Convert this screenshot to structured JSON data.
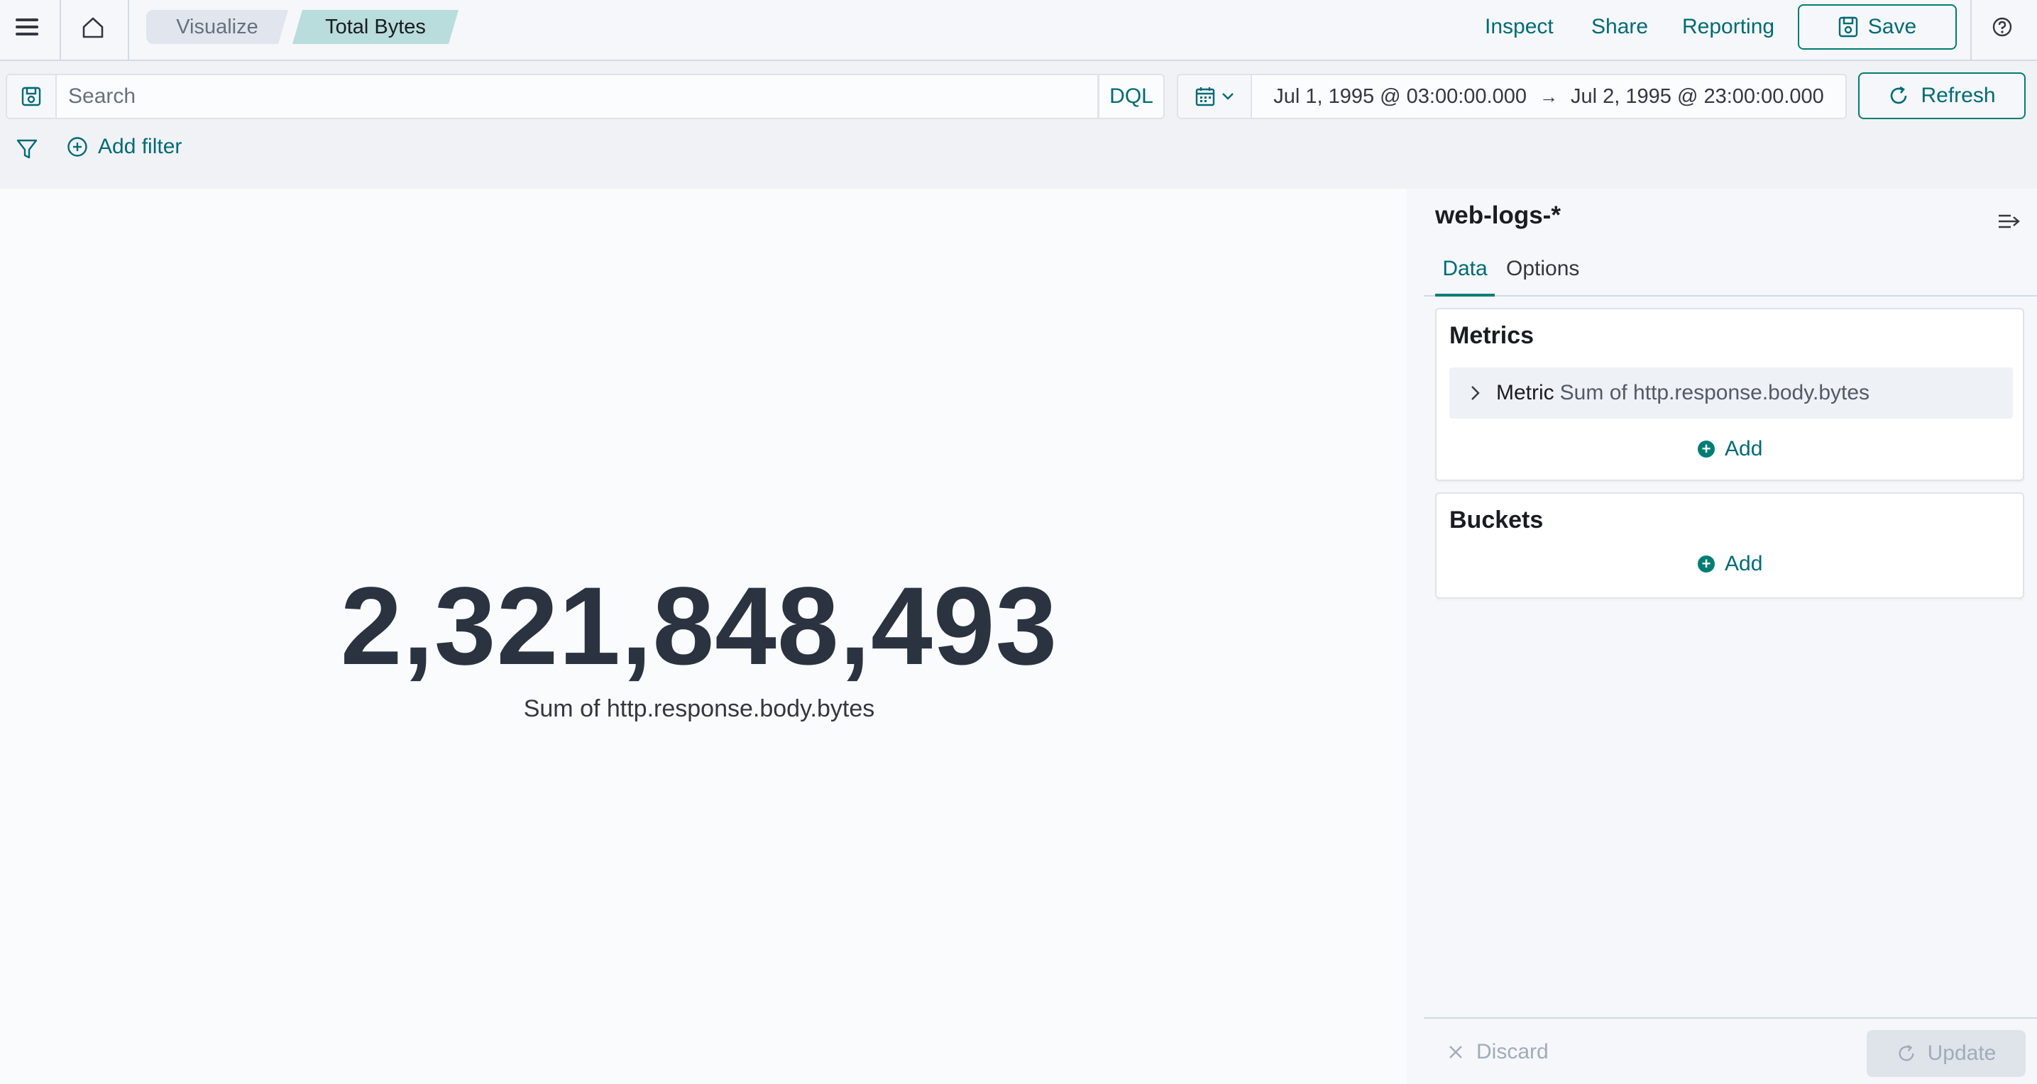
{
  "header": {
    "breadcrumbs": [
      "Visualize",
      "Total Bytes"
    ],
    "links": {
      "inspect": "Inspect",
      "share": "Share",
      "reporting": "Reporting"
    },
    "save_label": "Save",
    "icons": {
      "menu": "hamburger-menu-icon",
      "home": "home-icon",
      "save": "save-icon",
      "help": "help-icon"
    }
  },
  "query_bar": {
    "search_placeholder": "Search",
    "language": "DQL",
    "date_start": "Jul 1, 1995 @ 03:00:00.000",
    "date_end": "Jul 2, 1995 @ 23:00:00.000",
    "date_arrow": "→",
    "refresh_label": "Refresh"
  },
  "filters": {
    "add_filter_label": "Add filter"
  },
  "visualization": {
    "metric_value": "2,321,848,493",
    "metric_label": "Sum of http.response.body.bytes"
  },
  "sidebar": {
    "index_pattern": "web-logs-*",
    "tabs": [
      {
        "label": "Data",
        "active": true
      },
      {
        "label": "Options",
        "active": false
      }
    ],
    "metrics": {
      "title": "Metrics",
      "aggregations": [
        {
          "type": "Metric",
          "description": "Sum of http.response.body.bytes"
        }
      ],
      "add_label": "Add"
    },
    "buckets": {
      "title": "Buckets",
      "add_label": "Add"
    },
    "footer": {
      "discard_label": "Discard",
      "update_label": "Update"
    }
  },
  "colors": {
    "accent": "#017d73",
    "link": "#006b75",
    "metric_text": "#2b3340",
    "breadcrumb_active": "#b9dcdc"
  }
}
